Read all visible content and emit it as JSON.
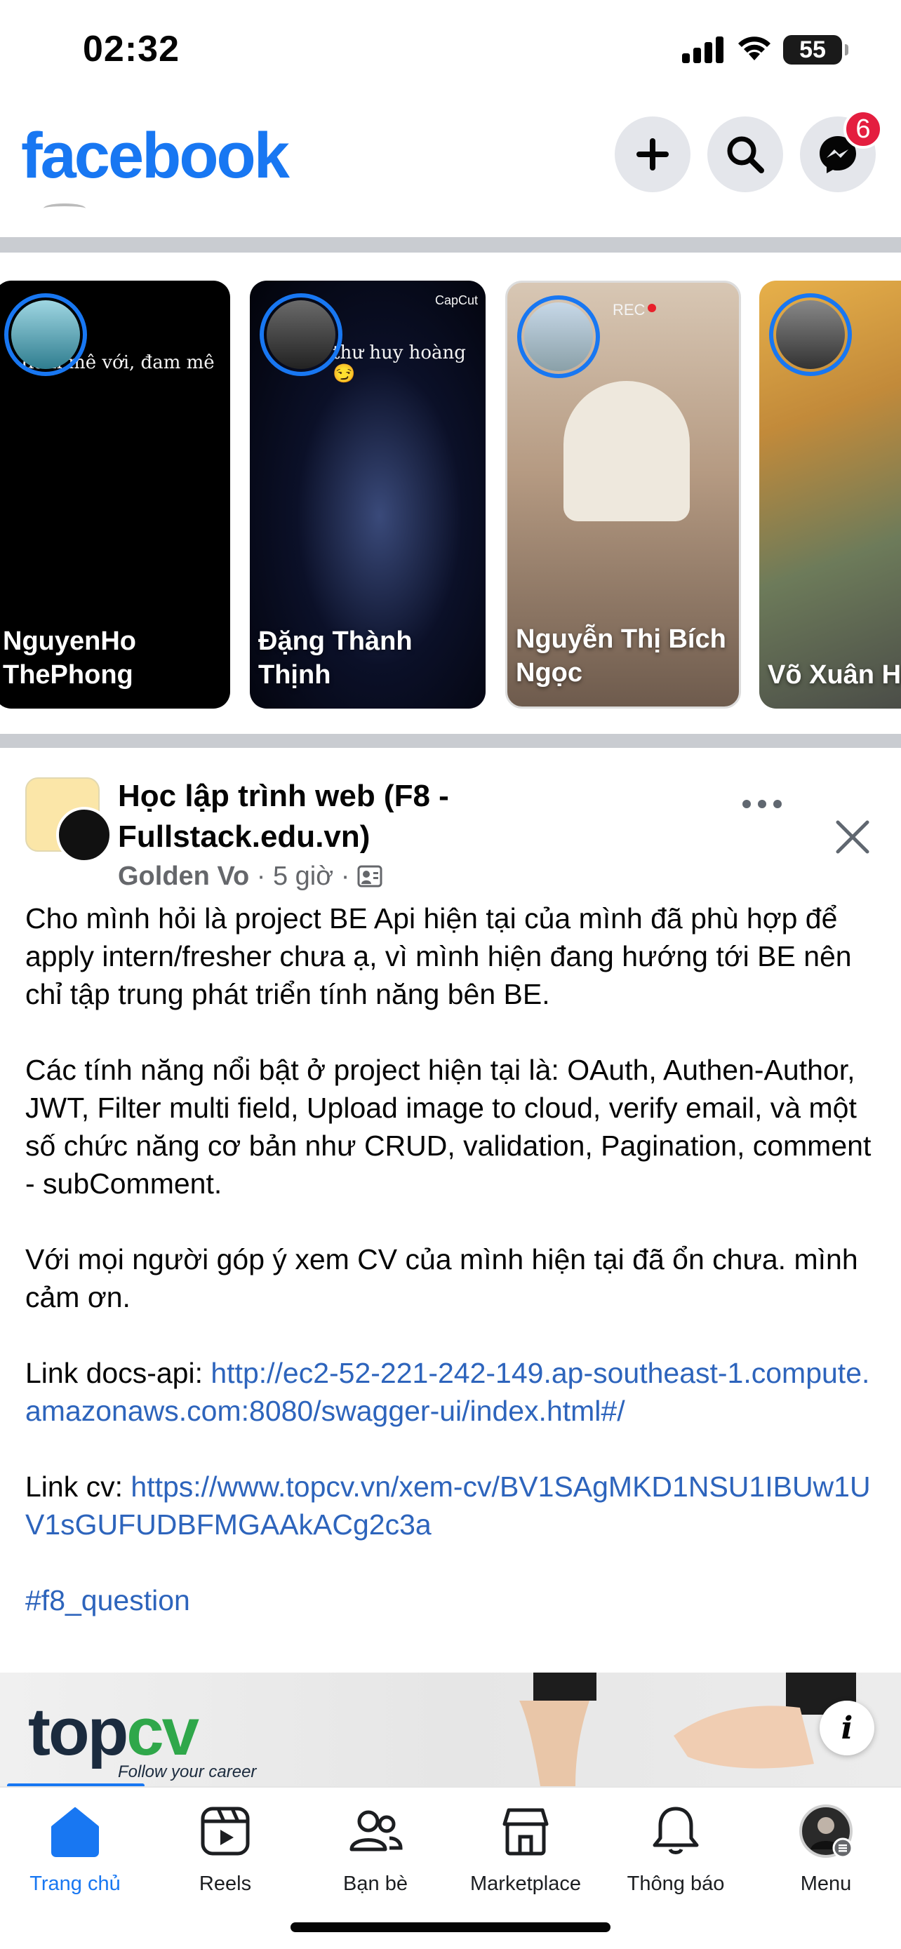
{
  "status": {
    "time": "02:32",
    "battery": "55"
  },
  "header": {
    "logo": "facebook",
    "messenger_badge": "6"
  },
  "stories": [
    {
      "name": "NguyenHo ThePhong",
      "overlay": "đam mê với, đam mê"
    },
    {
      "name": "Đặng Thành Thịnh",
      "overlay": "thư huy hoàng 😏",
      "brand": "CapCut"
    },
    {
      "name": "Nguyễn Thị Bích Ngọc",
      "overlay": "REC"
    },
    {
      "name": "Võ Xuân Hải"
    }
  ],
  "post": {
    "group": "Học lập trình web (F8 - Fullstack.edu.vn)",
    "author": "Golden Vo",
    "time": "5 giờ",
    "para1": "Cho mình hỏi là project BE Api hiện tại của mình đã phù hợp để apply intern/fresher chưa ạ, vì mình hiện đang hướng tới BE nên chỉ tập trung phát triển tính năng bên BE.",
    "para2": "Các tính năng nổi bật ở project hiện tại là: OAuth, Authen-Author, JWT, Filter multi field, Upload image to cloud, verify email, và một số chức năng cơ bản như CRUD, validation, Pagination, comment - subComment.",
    "para3": "Với mọi người góp ý xem CV của mình hiện tại đã ổn chưa. mình cảm ơn.",
    "docs_label": "Link docs-api: ",
    "docs_url": "http://ec2-52-221-242-149.ap-southeast-1.compute.amazonaws.com:8080/swagger-ui/index.html#/",
    "cv_label": "Link cv: ",
    "cv_url": "https://www.topcv.vn/xem-cv/BV1SAgMKD1NSU1IBUw1UV1sGUFUDBFMGAAkACg2c3a",
    "hashtag": "#f8_question"
  },
  "ad": {
    "logo_top": "top",
    "logo_cv": "cv",
    "tagline": "Follow your career",
    "info": "i"
  },
  "tabs": [
    {
      "label": "Trang chủ",
      "icon": "home-icon",
      "active": true
    },
    {
      "label": "Reels",
      "icon": "reels-icon"
    },
    {
      "label": "Bạn bè",
      "icon": "friends-icon"
    },
    {
      "label": "Marketplace",
      "icon": "marketplace-icon"
    },
    {
      "label": "Thông báo",
      "icon": "bell-icon"
    },
    {
      "label": "Menu",
      "icon": "profile-avatar"
    }
  ],
  "colors": {
    "brand": "#1877f2",
    "link": "#2d64bc",
    "badge": "#e41e3f"
  }
}
